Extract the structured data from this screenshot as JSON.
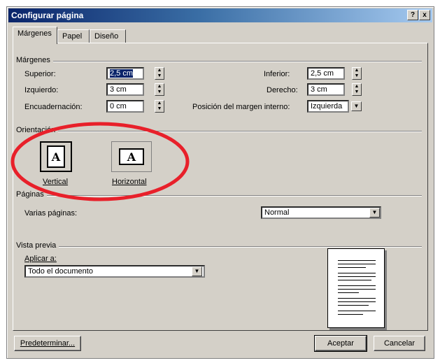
{
  "window": {
    "title": "Configurar página",
    "help_label": "?",
    "close_label": "x"
  },
  "tabs": [
    {
      "label": "Márgenes",
      "active": true
    },
    {
      "label": "Papel",
      "active": false
    },
    {
      "label": "Diseño",
      "active": false
    }
  ],
  "margins": {
    "group_title": "Márgenes",
    "superior": {
      "label": "Superior:",
      "value": "2,5 cm"
    },
    "izquierdo": {
      "label": "Izquierdo:",
      "value": "3 cm"
    },
    "encuadernacion": {
      "label": "Encuadernación:",
      "value": "0 cm"
    },
    "inferior": {
      "label": "Inferior:",
      "value": "2,5 cm"
    },
    "derecho": {
      "label": "Derecho:",
      "value": "3 cm"
    },
    "posicion": {
      "label": "Posición del margen interno:",
      "value": "Izquierda"
    }
  },
  "orientation": {
    "group_title": "Orientación",
    "vertical_label": "Vertical",
    "horizontal_label": "Horizontal",
    "icon_letter": "A",
    "selected": "vertical"
  },
  "pages": {
    "group_title": "Páginas",
    "multiple_label": "Varias páginas:",
    "multiple_value": "Normal"
  },
  "preview": {
    "group_title": "Vista previa",
    "apply_label": "Aplicar a:",
    "apply_value": "Todo el documento"
  },
  "buttons": {
    "default_label": "Predeterminar...",
    "ok_label": "Aceptar",
    "cancel_label": "Cancelar"
  },
  "colors": {
    "dialog_bg": "#d4d0c8",
    "title_bar": "#0a246a",
    "annotation_circle": "#e8202a"
  }
}
